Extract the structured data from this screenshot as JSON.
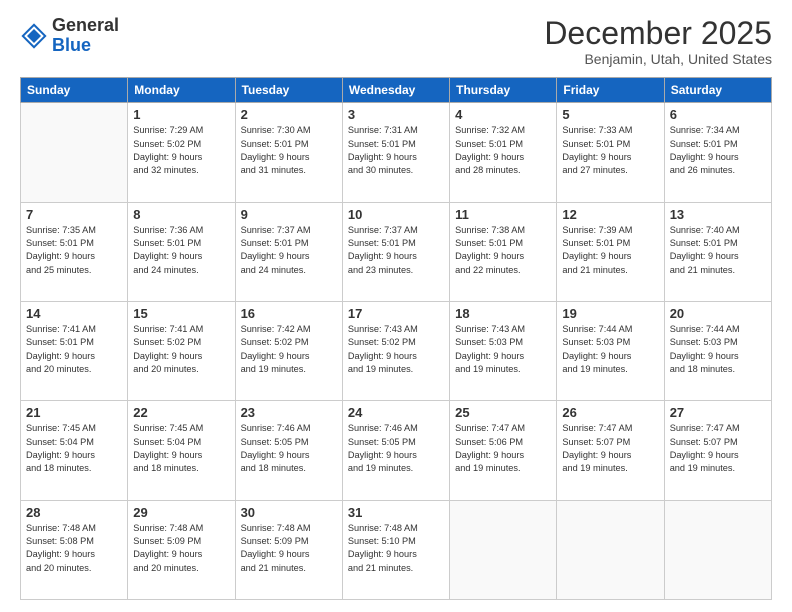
{
  "header": {
    "logo_general": "General",
    "logo_blue": "Blue",
    "month_title": "December 2025",
    "location": "Benjamin, Utah, United States"
  },
  "days_of_week": [
    "Sunday",
    "Monday",
    "Tuesday",
    "Wednesday",
    "Thursday",
    "Friday",
    "Saturday"
  ],
  "weeks": [
    [
      {
        "day": "",
        "info": ""
      },
      {
        "day": "1",
        "info": "Sunrise: 7:29 AM\nSunset: 5:02 PM\nDaylight: 9 hours\nand 32 minutes."
      },
      {
        "day": "2",
        "info": "Sunrise: 7:30 AM\nSunset: 5:01 PM\nDaylight: 9 hours\nand 31 minutes."
      },
      {
        "day": "3",
        "info": "Sunrise: 7:31 AM\nSunset: 5:01 PM\nDaylight: 9 hours\nand 30 minutes."
      },
      {
        "day": "4",
        "info": "Sunrise: 7:32 AM\nSunset: 5:01 PM\nDaylight: 9 hours\nand 28 minutes."
      },
      {
        "day": "5",
        "info": "Sunrise: 7:33 AM\nSunset: 5:01 PM\nDaylight: 9 hours\nand 27 minutes."
      },
      {
        "day": "6",
        "info": "Sunrise: 7:34 AM\nSunset: 5:01 PM\nDaylight: 9 hours\nand 26 minutes."
      }
    ],
    [
      {
        "day": "7",
        "info": "Sunrise: 7:35 AM\nSunset: 5:01 PM\nDaylight: 9 hours\nand 25 minutes."
      },
      {
        "day": "8",
        "info": "Sunrise: 7:36 AM\nSunset: 5:01 PM\nDaylight: 9 hours\nand 24 minutes."
      },
      {
        "day": "9",
        "info": "Sunrise: 7:37 AM\nSunset: 5:01 PM\nDaylight: 9 hours\nand 24 minutes."
      },
      {
        "day": "10",
        "info": "Sunrise: 7:37 AM\nSunset: 5:01 PM\nDaylight: 9 hours\nand 23 minutes."
      },
      {
        "day": "11",
        "info": "Sunrise: 7:38 AM\nSunset: 5:01 PM\nDaylight: 9 hours\nand 22 minutes."
      },
      {
        "day": "12",
        "info": "Sunrise: 7:39 AM\nSunset: 5:01 PM\nDaylight: 9 hours\nand 21 minutes."
      },
      {
        "day": "13",
        "info": "Sunrise: 7:40 AM\nSunset: 5:01 PM\nDaylight: 9 hours\nand 21 minutes."
      }
    ],
    [
      {
        "day": "14",
        "info": "Sunrise: 7:41 AM\nSunset: 5:01 PM\nDaylight: 9 hours\nand 20 minutes."
      },
      {
        "day": "15",
        "info": "Sunrise: 7:41 AM\nSunset: 5:02 PM\nDaylight: 9 hours\nand 20 minutes."
      },
      {
        "day": "16",
        "info": "Sunrise: 7:42 AM\nSunset: 5:02 PM\nDaylight: 9 hours\nand 19 minutes."
      },
      {
        "day": "17",
        "info": "Sunrise: 7:43 AM\nSunset: 5:02 PM\nDaylight: 9 hours\nand 19 minutes."
      },
      {
        "day": "18",
        "info": "Sunrise: 7:43 AM\nSunset: 5:03 PM\nDaylight: 9 hours\nand 19 minutes."
      },
      {
        "day": "19",
        "info": "Sunrise: 7:44 AM\nSunset: 5:03 PM\nDaylight: 9 hours\nand 19 minutes."
      },
      {
        "day": "20",
        "info": "Sunrise: 7:44 AM\nSunset: 5:03 PM\nDaylight: 9 hours\nand 18 minutes."
      }
    ],
    [
      {
        "day": "21",
        "info": "Sunrise: 7:45 AM\nSunset: 5:04 PM\nDaylight: 9 hours\nand 18 minutes."
      },
      {
        "day": "22",
        "info": "Sunrise: 7:45 AM\nSunset: 5:04 PM\nDaylight: 9 hours\nand 18 minutes."
      },
      {
        "day": "23",
        "info": "Sunrise: 7:46 AM\nSunset: 5:05 PM\nDaylight: 9 hours\nand 18 minutes."
      },
      {
        "day": "24",
        "info": "Sunrise: 7:46 AM\nSunset: 5:05 PM\nDaylight: 9 hours\nand 19 minutes."
      },
      {
        "day": "25",
        "info": "Sunrise: 7:47 AM\nSunset: 5:06 PM\nDaylight: 9 hours\nand 19 minutes."
      },
      {
        "day": "26",
        "info": "Sunrise: 7:47 AM\nSunset: 5:07 PM\nDaylight: 9 hours\nand 19 minutes."
      },
      {
        "day": "27",
        "info": "Sunrise: 7:47 AM\nSunset: 5:07 PM\nDaylight: 9 hours\nand 19 minutes."
      }
    ],
    [
      {
        "day": "28",
        "info": "Sunrise: 7:48 AM\nSunset: 5:08 PM\nDaylight: 9 hours\nand 20 minutes."
      },
      {
        "day": "29",
        "info": "Sunrise: 7:48 AM\nSunset: 5:09 PM\nDaylight: 9 hours\nand 20 minutes."
      },
      {
        "day": "30",
        "info": "Sunrise: 7:48 AM\nSunset: 5:09 PM\nDaylight: 9 hours\nand 21 minutes."
      },
      {
        "day": "31",
        "info": "Sunrise: 7:48 AM\nSunset: 5:10 PM\nDaylight: 9 hours\nand 21 minutes."
      },
      {
        "day": "",
        "info": ""
      },
      {
        "day": "",
        "info": ""
      },
      {
        "day": "",
        "info": ""
      }
    ]
  ]
}
